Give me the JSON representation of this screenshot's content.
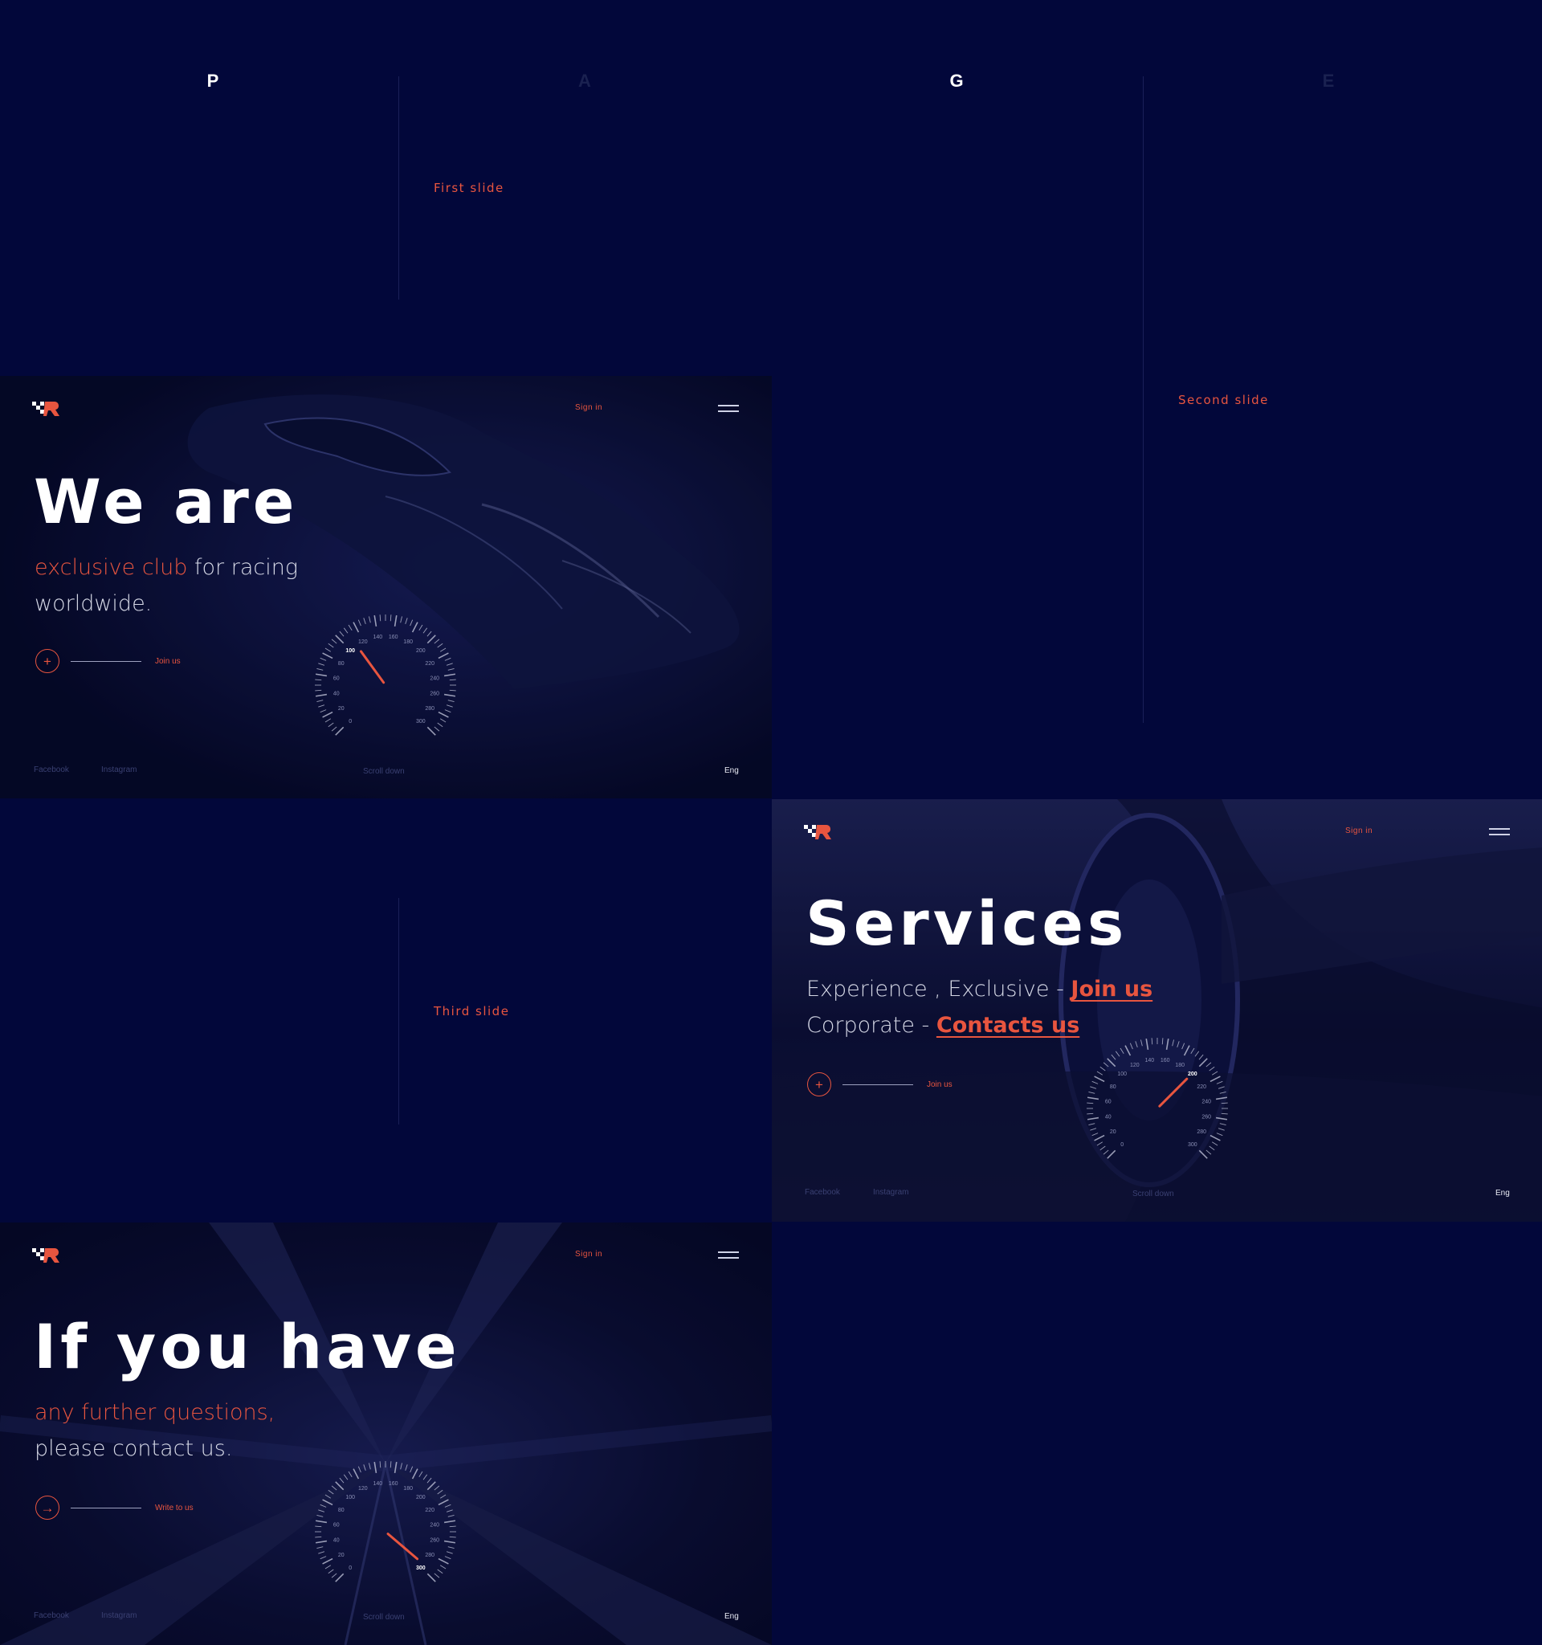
{
  "page_letters": [
    "P",
    "A",
    "G",
    "E"
  ],
  "slide_labels": {
    "first": "First slide",
    "second": "Second slide",
    "third": "Third slide"
  },
  "common": {
    "sign_in": "Sign in",
    "facebook": "Facebook",
    "instagram": "Instagram",
    "scroll_down": "Scroll down",
    "language": "Eng"
  },
  "slide1": {
    "headline": "We are",
    "accent": "exclusive club",
    "rest_line1": " for racing",
    "line2": "worldwide.",
    "cta": "Join us",
    "cta_icon": "plus-icon"
  },
  "slide2": {
    "headline": "Services",
    "line1_text": "Experience , Exclusive - ",
    "line1_link": "Join us",
    "line2_text": "Corporate - ",
    "line2_link": "Contacts us",
    "cta": "Join us",
    "cta_icon": "plus-icon"
  },
  "slide3": {
    "headline": "If you have",
    "accent_line": "any further questions,",
    "line2": "please contact us.",
    "cta": "Write to us",
    "cta_icon": "arrow-right-icon"
  },
  "speedometer": {
    "ticks": [
      "0",
      "20",
      "40",
      "60",
      "80",
      "100",
      "120",
      "140",
      "160",
      "180",
      "200",
      "220",
      "240",
      "260",
      "280",
      "300"
    ],
    "readings": [
      100,
      200,
      300
    ]
  },
  "colors": {
    "background": "#02073a",
    "accent": "#e8553f",
    "panel": "#060a2e"
  }
}
